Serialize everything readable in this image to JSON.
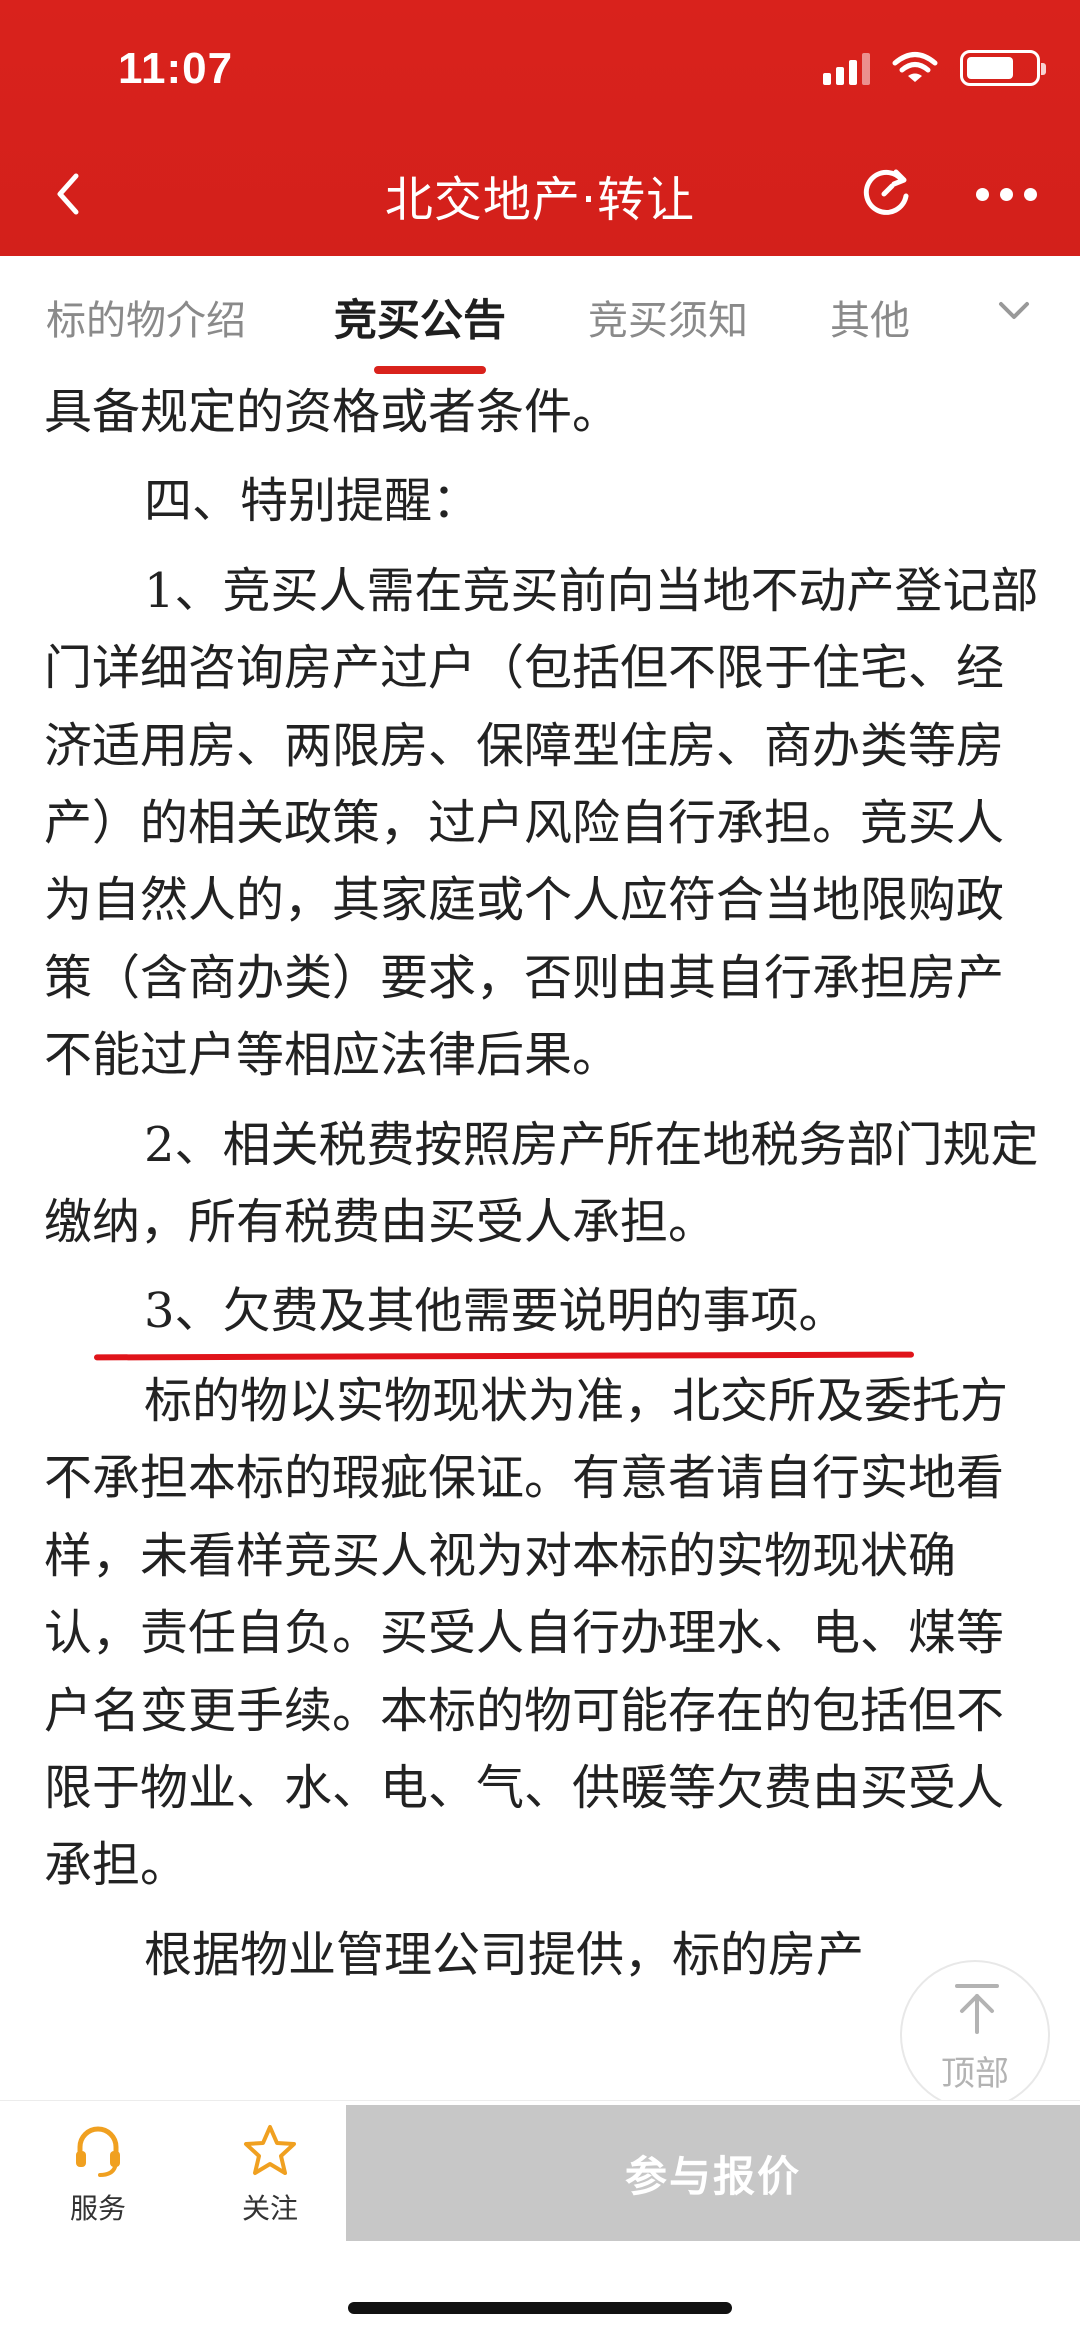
{
  "status_bar": {
    "time": "11:07"
  },
  "nav": {
    "title": "北交地产·转让"
  },
  "tabs": [
    {
      "label": "标的物介绍",
      "active": false
    },
    {
      "label": "竞买公告",
      "active": true
    },
    {
      "label": "竞买须知",
      "active": false
    },
    {
      "label": "其他",
      "active": false
    }
  ],
  "content": {
    "paragraphs": [
      "具备规定的资格或者条件。",
      "四、特别提醒：",
      "1、竞买人需在竞买前向当地不动产登记部门详细咨询房产过户（包括但不限于住宅、经济适用房、两限房、保障型住房、商办类等房产）的相关政策，过户风险自行承担。竞买人为自然人的，其家庭或个人应符合当地限购政策（含商办类）要求，否则由其自行承担房产不能过户等相应法律后果。",
      "2、相关税费按照房产所在地税务部门规定缴纳，所有税费由买受人承担。",
      "3、欠费及其他需要说明的事项。",
      "标的物以实物现状为准，北交所及委托方不承担本标的瑕疵保证。有意者请自行实地看样，未看样竞买人视为对本标的实物现状确认，责任自负。买受人自行办理水、电、煤等户名变更手续。本标的物可能存在的包括但不限于物业、水、电、气、供暖等欠费由买受人承担。",
      "根据物业管理公司提供，标的房产"
    ]
  },
  "top_button": {
    "label": "顶部"
  },
  "bottom_bar": {
    "service_label": "服务",
    "follow_label": "关注",
    "bid_label": "参与报价"
  },
  "colors": {
    "brand_red": "#d9221c",
    "underline_red": "#e0141a",
    "icon_orange": "#f0a020",
    "disabled_gray": "#c7c7c7"
  }
}
